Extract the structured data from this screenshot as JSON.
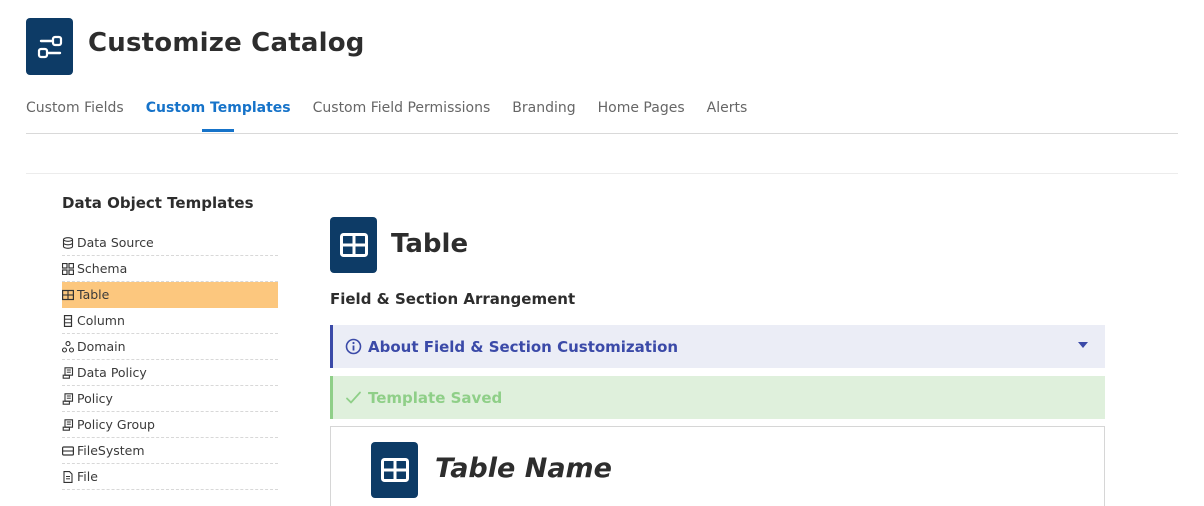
{
  "header": {
    "title": "Customize Catalog",
    "icon": "sliders-icon"
  },
  "tabs": [
    {
      "label": "Custom Fields",
      "active": false
    },
    {
      "label": "Custom Templates",
      "active": true
    },
    {
      "label": "Custom Field Permissions",
      "active": false
    },
    {
      "label": "Branding",
      "active": false
    },
    {
      "label": "Home Pages",
      "active": false
    },
    {
      "label": "Alerts",
      "active": false
    }
  ],
  "sidebar": {
    "title": "Data Object Templates",
    "items": [
      {
        "label": "Data Source",
        "icon": "database-icon",
        "selected": false
      },
      {
        "label": "Schema",
        "icon": "schema-grid-icon",
        "selected": false
      },
      {
        "label": "Table",
        "icon": "table-icon",
        "selected": true
      },
      {
        "label": "Column",
        "icon": "column-icon",
        "selected": false
      },
      {
        "label": "Domain",
        "icon": "domain-icon",
        "selected": false
      },
      {
        "label": "Data Policy",
        "icon": "policy-icon",
        "selected": false
      },
      {
        "label": "Policy",
        "icon": "policy-icon",
        "selected": false
      },
      {
        "label": "Policy Group",
        "icon": "policy-icon",
        "selected": false
      },
      {
        "label": "FileSystem",
        "icon": "filesystem-icon",
        "selected": false
      },
      {
        "label": "File",
        "icon": "file-icon",
        "selected": false
      }
    ]
  },
  "main": {
    "object_title": "Table",
    "object_icon": "table-icon",
    "section_heading": "Field & Section Arrangement",
    "about_label": "About Field & Section Customization",
    "saved_label": "Template Saved",
    "card_title": "Table Name"
  },
  "colors": {
    "navy": "#0d3b66",
    "accent_blue": "#1673c9",
    "selected_orange": "#fcc77e",
    "info_indigo": "#3b4aa8",
    "success_green": "#8fcf88"
  }
}
